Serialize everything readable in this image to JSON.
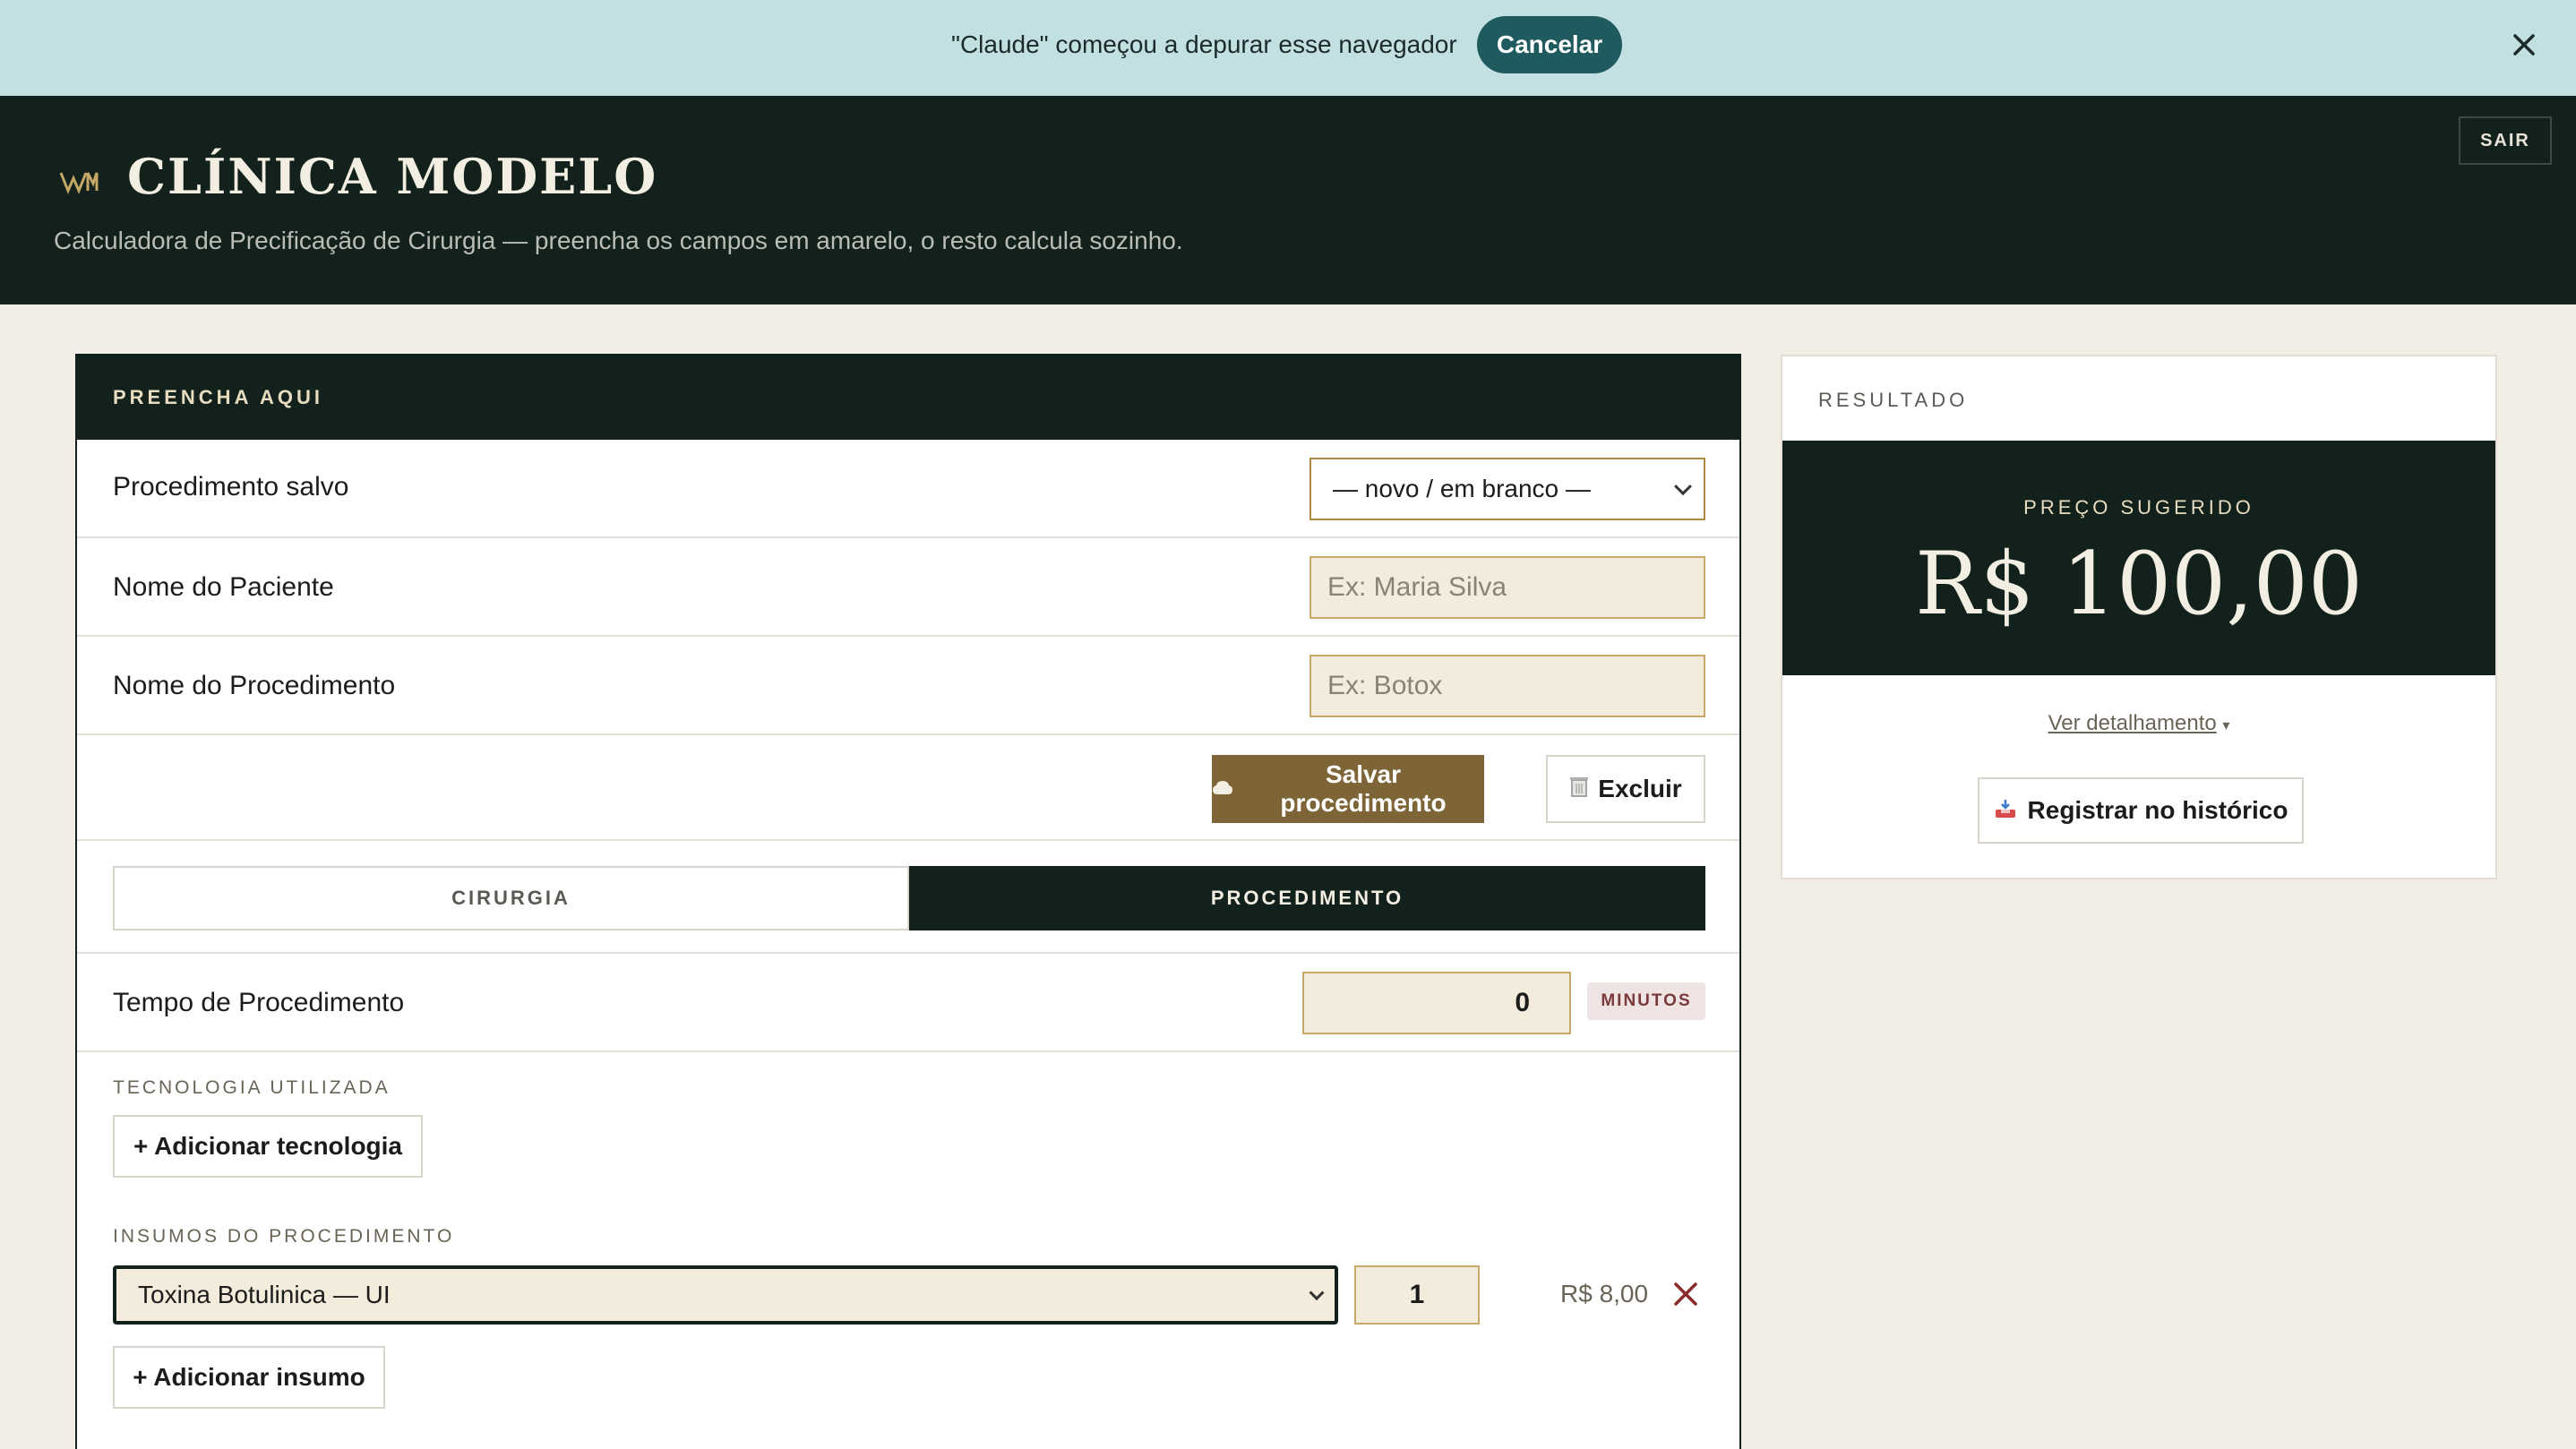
{
  "debug_bar": {
    "message": "\"Claude\" começou a depurar esse navegador",
    "cancel_label": "Cancelar",
    "close_icon": "close-icon"
  },
  "header": {
    "logo_icon": "clinic-logo-icon",
    "clinic_name": "CLÍNICA MODELO",
    "subtitle": "Calculadora de Precificação de Cirurgia — preencha os campos em amarelo, o resto calcula sozinho.",
    "logout_label": "SAIR"
  },
  "form": {
    "panel_title": "PREENCHA AQUI",
    "saved_procedure": {
      "label": "Procedimento salvo",
      "selected": "— novo / em branco —"
    },
    "patient_name": {
      "label": "Nome do Paciente",
      "value": "",
      "placeholder": "Ex: Maria Silva"
    },
    "procedure_name": {
      "label": "Nome do Procedimento",
      "value": "",
      "placeholder": "Ex: Botox"
    },
    "save_button": {
      "icon": "save-icon",
      "label": "Salvar procedimento"
    },
    "delete_button": {
      "icon": "trash-icon",
      "label": "Excluir"
    },
    "tabs": [
      {
        "label": "CIRURGIA",
        "active": false
      },
      {
        "label": "PROCEDIMENTO",
        "active": true
      }
    ],
    "procedure_time": {
      "label": "Tempo de Procedimento",
      "value": "0",
      "unit": "MINUTOS"
    },
    "technology": {
      "section_label": "TECNOLOGIA UTILIZADA",
      "add_label": "+ Adicionar tecnologia"
    },
    "supplies": {
      "section_label": "INSUMOS DO PROCEDIMENTO",
      "items": [
        {
          "selected": "Toxina Botulinica — UI",
          "quantity": "1",
          "price": "R$ 8,00"
        }
      ],
      "add_label": "+ Adicionar insumo"
    }
  },
  "result": {
    "title": "RESULTADO",
    "price_label": "PREÇO SUGERIDO",
    "price_value": "R$ 100,00",
    "details_link": "Ver detalhamento",
    "history_button": {
      "icon": "inbox-icon",
      "label": "Registrar no histórico"
    }
  },
  "colors": {
    "dark_green": "#12211b",
    "gold": "#7e6538",
    "input_fill": "#f3ebdc",
    "debug_bar": "#c2e0e2",
    "cancel_button": "#1f5a5e",
    "background": "#f2eee7"
  }
}
